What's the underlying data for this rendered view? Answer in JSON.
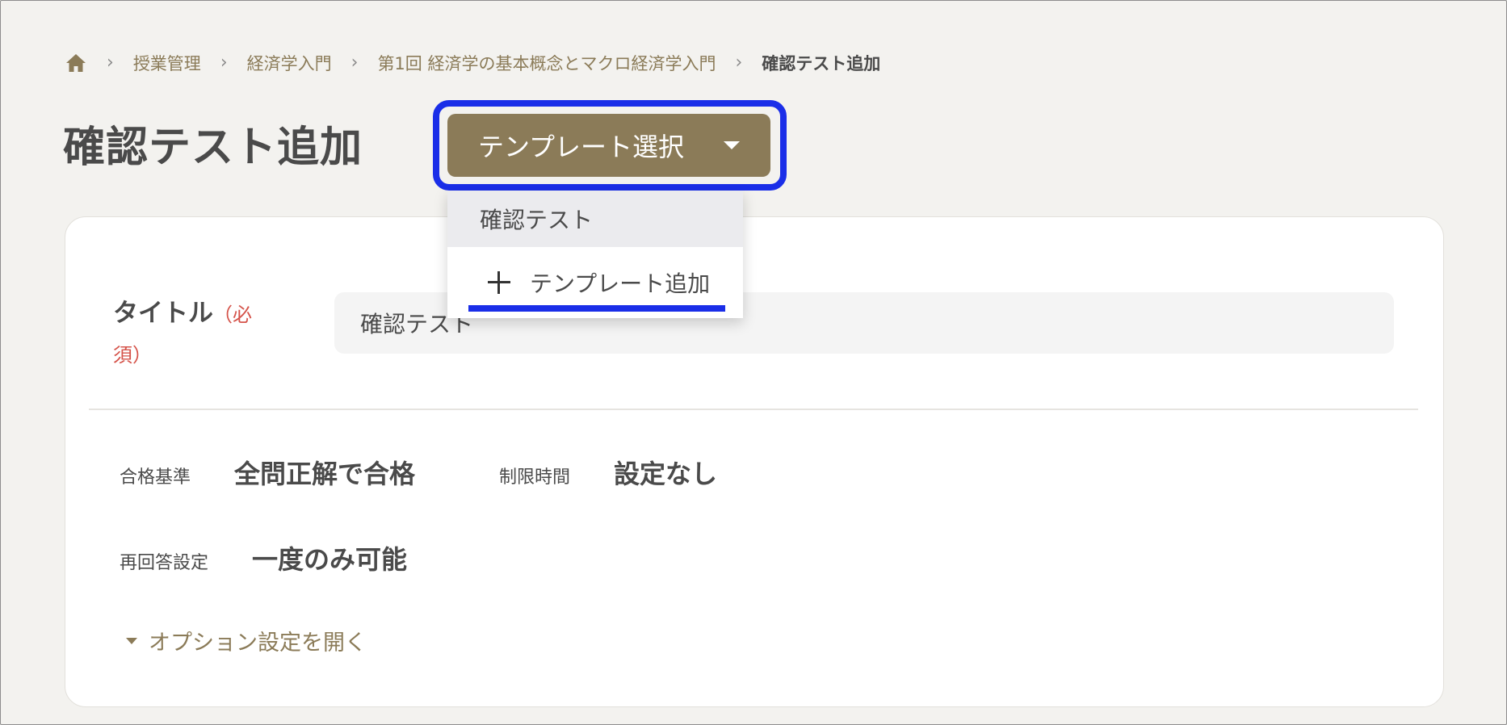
{
  "breadcrumb": {
    "home_icon": "home-icon",
    "items": [
      "授業管理",
      "経済学入門",
      "第1回 経済学の基本概念とマクロ経済学入門"
    ],
    "current": "確認テスト追加",
    "separator": "›"
  },
  "page": {
    "title": "確認テスト追加"
  },
  "template_select": {
    "label": "テンプレート選択",
    "menu": {
      "items": [
        "確認テスト"
      ],
      "add_label": "テンプレート追加"
    }
  },
  "form": {
    "title_label": "タイトル",
    "required_mark": "（必須）",
    "title_value": "確認テスト",
    "settings": {
      "pass_criteria_label": "合格基準",
      "pass_criteria_value": "全問正解で合格",
      "time_limit_label": "制限時間",
      "time_limit_value": "設定なし",
      "retry_label": "再回答設定",
      "retry_value": "一度のみ可能"
    },
    "options_toggle": "オプション設定を開く"
  },
  "colors": {
    "accent": "#8b7b58",
    "focus_ring": "#1a2ee8",
    "required": "#d5534a",
    "background": "#f3f2ef"
  }
}
